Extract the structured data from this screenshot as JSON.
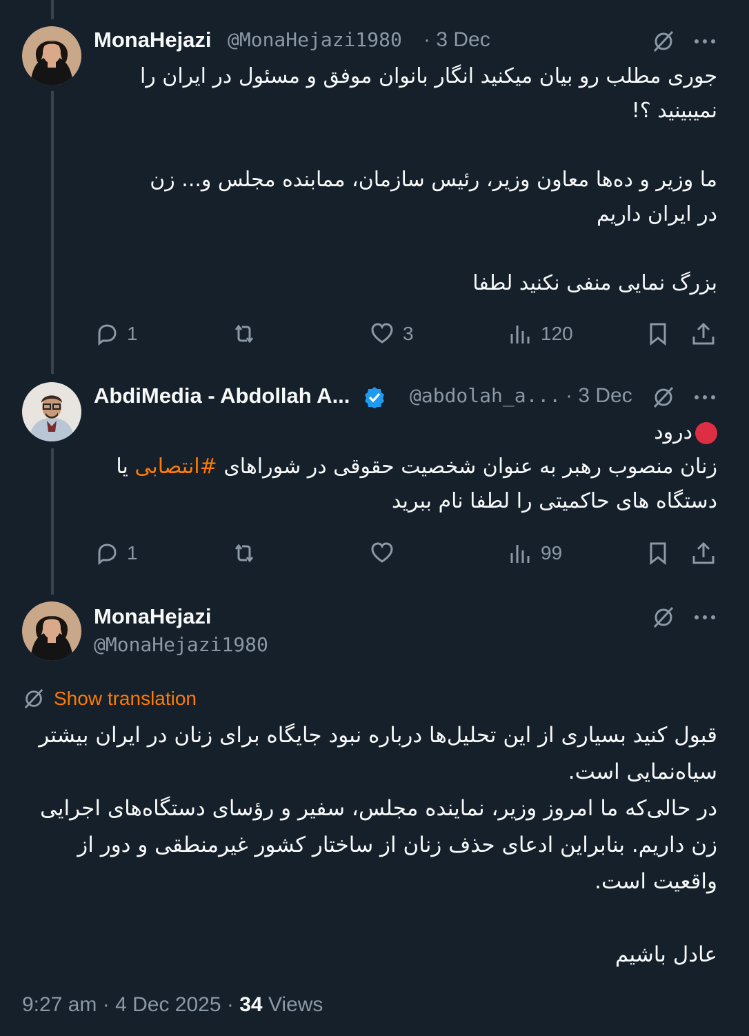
{
  "colors": {
    "background": "#15202b",
    "text": "#f7f9f9",
    "muted": "#8b98a5",
    "accent": "#ff7a00",
    "verified": "#1d9bf0",
    "line": "#38444d"
  },
  "tweets": [
    {
      "name": "MonaHejazi",
      "handle": "@MonaHejazi1980",
      "dot": "·",
      "date": "3 Dec",
      "paragraphs": [
        "جوری مطلب رو بیان میکنید انگار بانوان موفق و مسئول در ایران را نمیبینید ؟!",
        "ما وزیر و ده‌ها معاون وزیر، رئیس سازمان، ممابنده مجلس و... زن در ایران داریم",
        "بزرگ نمایی منفی نکنید لطفا"
      ],
      "replies": "1",
      "reposts": "",
      "likes": "3",
      "views": "120"
    },
    {
      "name": "AbdiMedia - Abdollah A...",
      "handle": "@abdolah_a...",
      "dot": "·",
      "date": "3 Dec",
      "greeting": "درود",
      "line_before_hashtag": "زنان منصوب رهبر به عنوان شخصیت حقوقی در شوراهای ",
      "hashtag": "#انتصابی",
      "line_after_hashtag": " یا دستگاه های حاکمیتی را لطفا نام ببرید",
      "replies": "1",
      "reposts": "",
      "likes": "",
      "views": "99"
    }
  ],
  "main_tweet": {
    "name": "MonaHejazi",
    "handle": "@MonaHejazi1980",
    "show_translation": "Show translation",
    "paragraphs": [
      "قبول کنید بسیاری از این تحلیل‌ها درباره نبود جایگاه برای زنان در ایران بیشتر سیاه‌نمایی است.",
      "در حالی‌که ما امروز وزیر، نماینده مجلس، سفیر و رؤسای دستگاه‌های اجرایی زن داریم. بنابراین ادعای حذف زنان از ساختار کشور غیرمنطقی و دور از واقعیت است.",
      "عادل باشیم"
    ],
    "time": "9:27 am",
    "sep": "·",
    "date": "4 Dec 2025",
    "views_count": "34",
    "views_label": "Views"
  },
  "icons": [
    "reply-icon",
    "repost-icon",
    "like-icon",
    "views-icon",
    "bookmark-icon",
    "share-icon",
    "grok-icon",
    "more-icon",
    "verified-icon",
    "translate-icon"
  ]
}
